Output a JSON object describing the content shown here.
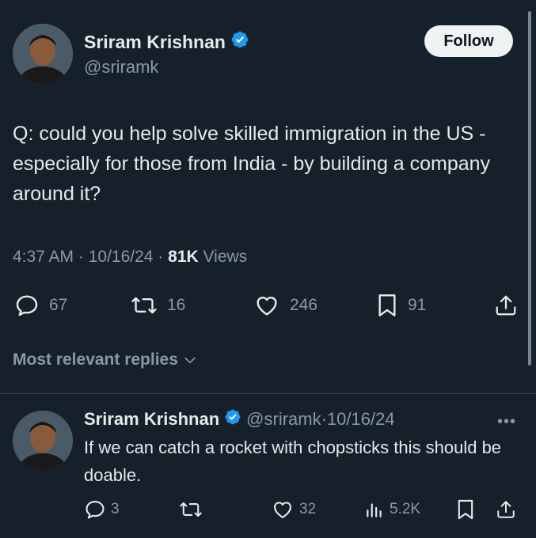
{
  "tweet": {
    "author_name": "Sriram Krishnan",
    "author_handle": "@sriramk",
    "follow_label": "Follow",
    "text": "Q: could you help solve skilled immigration in the US - especially for those from India - by building a company around it?",
    "time": "4:37 AM",
    "date": "10/16/24",
    "views_count": "81K",
    "views_label": "Views",
    "replies": "67",
    "reposts": "16",
    "likes": "246",
    "bookmarks": "91"
  },
  "replies_section": {
    "sort_label": "Most relevant replies"
  },
  "reply": {
    "author_name": "Sriram Krishnan",
    "author_handle": "@sriramk",
    "date": "10/16/24",
    "text": "If we can catch a rocket with chopsticks this should be doable.",
    "replies": "3",
    "reposts": "",
    "likes": "32",
    "views": "5.2K"
  },
  "colors": {
    "background": "#15202b",
    "text_primary": "#e7e9ea",
    "text_secondary": "#8b98a5",
    "verified": "#1d9bf0",
    "follow_bg": "#eff3f4"
  },
  "icons": [
    "verified-badge-icon",
    "reply-icon",
    "repost-icon",
    "like-icon",
    "bookmark-icon",
    "share-icon",
    "views-icon",
    "chevron-down-icon",
    "more-icon"
  ]
}
